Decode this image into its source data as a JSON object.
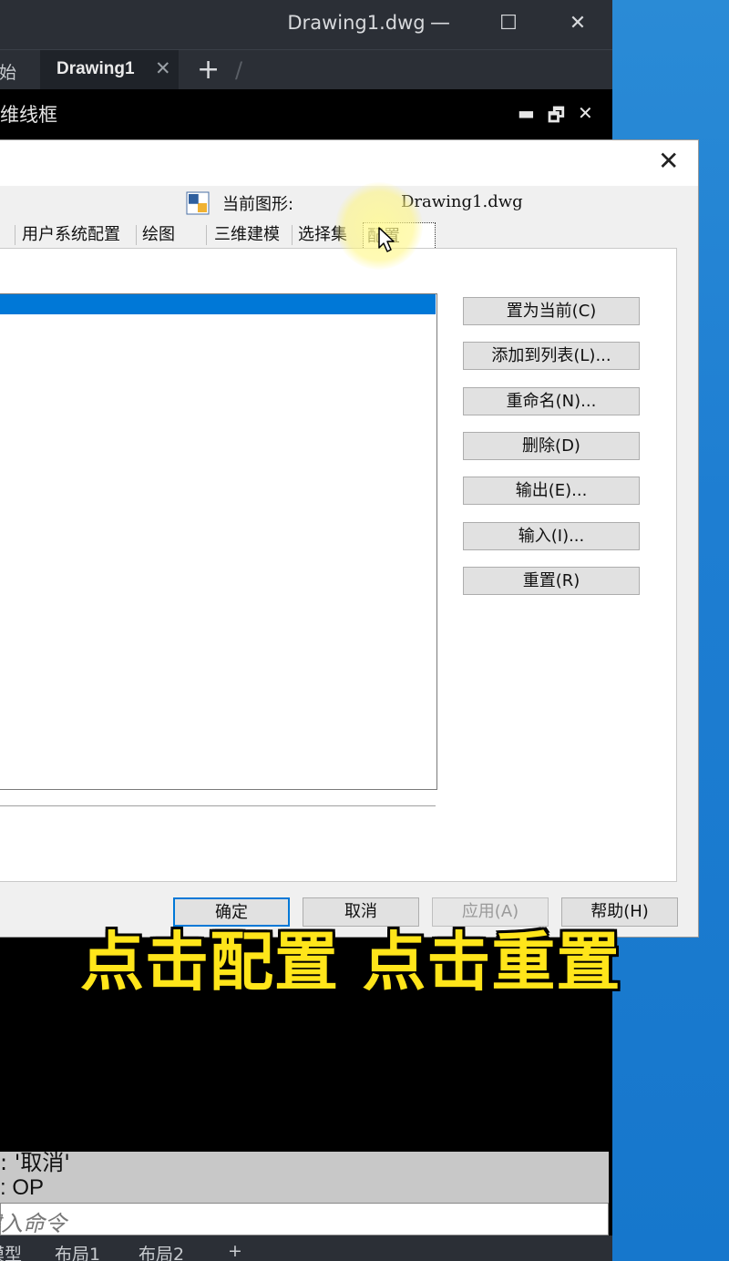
{
  "window": {
    "title": "Drawing1.dwg",
    "minimize_glyph": "—",
    "maximize_glyph": "☐",
    "close_glyph": "✕"
  },
  "tabs": {
    "start_label": "开始",
    "drawing_label": "Drawing1",
    "close_glyph": "✕",
    "add_glyph": "+",
    "sep_glyph": "/"
  },
  "viewport": {
    "label": "维线框",
    "controls": [
      "▬",
      "🗗",
      "✕"
    ]
  },
  "dialog": {
    "close_glyph": "✕",
    "current_drawing_label": "当前图形:",
    "current_drawing_value": "Drawing1.dwg",
    "tabs": [
      {
        "label": "用户系统配置"
      },
      {
        "label": "绘图"
      },
      {
        "label": "三维建模"
      },
      {
        "label": "选择集"
      },
      {
        "label": "配置",
        "active": true
      }
    ],
    "buttons": [
      {
        "label": "置为当前(C)"
      },
      {
        "label": "添加到列表(L)..."
      },
      {
        "label": "重命名(N)..."
      },
      {
        "label": "删除(D)"
      },
      {
        "label": "输出(E)..."
      },
      {
        "label": "输入(I)..."
      },
      {
        "label": "重置(R)"
      }
    ],
    "footer": {
      "ok": "确定",
      "cancel": "取消",
      "apply": "应用(A)",
      "help": "帮助(H)"
    }
  },
  "command": {
    "history_line1": ": '取消'",
    "history_line2": ": OP",
    "input_placeholder": "键入命令"
  },
  "layout_tabs": [
    "模型",
    "布局1",
    "布局2",
    "+"
  ],
  "caption": "点击配置 点击重置",
  "colors": {
    "accent": "#0078d7",
    "caption": "#ffe51a",
    "desktop": "#1e7ed2",
    "titlebar": "#2b2f36"
  }
}
